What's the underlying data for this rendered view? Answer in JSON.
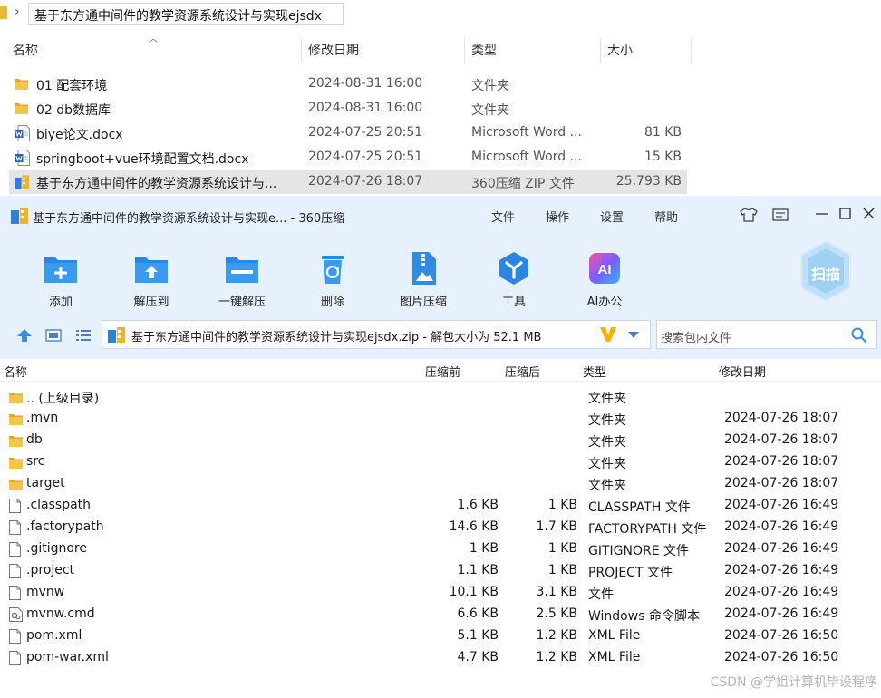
{
  "explorer": {
    "path": "基于东方通中间件的教学资源系统设计与实现ejsdx",
    "columns": {
      "name": "名称",
      "modified": "修改日期",
      "type": "类型",
      "size": "大小"
    },
    "rows": [
      {
        "name": "01 配套环境",
        "modified": "2024-08-31 16:00",
        "type": "文件夹",
        "size": "",
        "icon": "folder-icon"
      },
      {
        "name": "02 db数据库",
        "modified": "2024-08-31 16:00",
        "type": "文件夹",
        "size": "",
        "icon": "folder-icon"
      },
      {
        "name": "biye论文.docx",
        "modified": "2024-07-25 20:51",
        "type": "Microsoft Word ...",
        "size": "81 KB",
        "icon": "word-doc-icon"
      },
      {
        "name": "springboot+vue环境配置文档.docx",
        "modified": "2024-07-25 20:51",
        "type": "Microsoft Word ...",
        "size": "15 KB",
        "icon": "word-doc-icon"
      },
      {
        "name": "基于东方通中间件的教学资源系统设计与...",
        "modified": "2024-07-26 18:07",
        "type": "360压缩 ZIP 文件",
        "size": "25,793 KB",
        "icon": "zip-archive-icon"
      }
    ]
  },
  "zip": {
    "title": "基于东方通中间件的教学资源系统设计与实现e... - 360压缩",
    "menu": [
      "文件",
      "操作",
      "设置",
      "帮助"
    ],
    "toolbar": [
      "添加",
      "解压到",
      "一键解压",
      "删除",
      "图片压缩",
      "工具",
      "AI办公"
    ],
    "scan_label": "扫描",
    "ai_badge": "AI",
    "archive_path": "基于东方通中间件的教学资源系统设计与实现ejsdx.zip - 解包大小为 52.1 MB",
    "search_placeholder": "搜索包内文件",
    "columns": {
      "name": "名称",
      "before": "压缩前",
      "after": "压缩后",
      "type": "类型",
      "modified": "修改日期"
    },
    "rows": [
      {
        "name": ".. (上级目录)",
        "before": "",
        "after": "",
        "type": "文件夹",
        "modified": "",
        "icon": "folder-icon"
      },
      {
        "name": ".mvn",
        "before": "",
        "after": "",
        "type": "文件夹",
        "modified": "2024-07-26 18:07",
        "icon": "folder-icon"
      },
      {
        "name": "db",
        "before": "",
        "after": "",
        "type": "文件夹",
        "modified": "2024-07-26 18:07",
        "icon": "folder-icon"
      },
      {
        "name": "src",
        "before": "",
        "after": "",
        "type": "文件夹",
        "modified": "2024-07-26 18:07",
        "icon": "folder-icon"
      },
      {
        "name": "target",
        "before": "",
        "after": "",
        "type": "文件夹",
        "modified": "2024-07-26 18:07",
        "icon": "folder-icon"
      },
      {
        "name": ".classpath",
        "before": "1.6 KB",
        "after": "1 KB",
        "type": "CLASSPATH 文件",
        "modified": "2024-07-26 16:49",
        "icon": "file-icon"
      },
      {
        "name": ".factorypath",
        "before": "14.6 KB",
        "after": "1.7 KB",
        "type": "FACTORYPATH 文件",
        "modified": "2024-07-26 16:49",
        "icon": "file-icon"
      },
      {
        "name": ".gitignore",
        "before": "1 KB",
        "after": "1 KB",
        "type": "GITIGNORE 文件",
        "modified": "2024-07-26 16:49",
        "icon": "file-icon"
      },
      {
        "name": ".project",
        "before": "1.1 KB",
        "after": "1 KB",
        "type": "PROJECT 文件",
        "modified": "2024-07-26 16:49",
        "icon": "file-icon"
      },
      {
        "name": "mvnw",
        "before": "10.1 KB",
        "after": "3.1 KB",
        "type": "文件",
        "modified": "2024-07-26 16:49",
        "icon": "file-icon"
      },
      {
        "name": "mvnw.cmd",
        "before": "6.6 KB",
        "after": "2.5 KB",
        "type": "Windows 命令脚本",
        "modified": "2024-07-26 16:49",
        "icon": "cmd-script-icon"
      },
      {
        "name": "pom.xml",
        "before": "5.1 KB",
        "after": "1.2 KB",
        "type": "XML File",
        "modified": "2024-07-26 16:50",
        "icon": "file-icon"
      },
      {
        "name": "pom-war.xml",
        "before": "4.7 KB",
        "after": "1.2 KB",
        "type": "XML File",
        "modified": "2024-07-26 16:50",
        "icon": "file-icon"
      }
    ]
  },
  "watermark": "CSDN @学姐计算机毕设程序"
}
